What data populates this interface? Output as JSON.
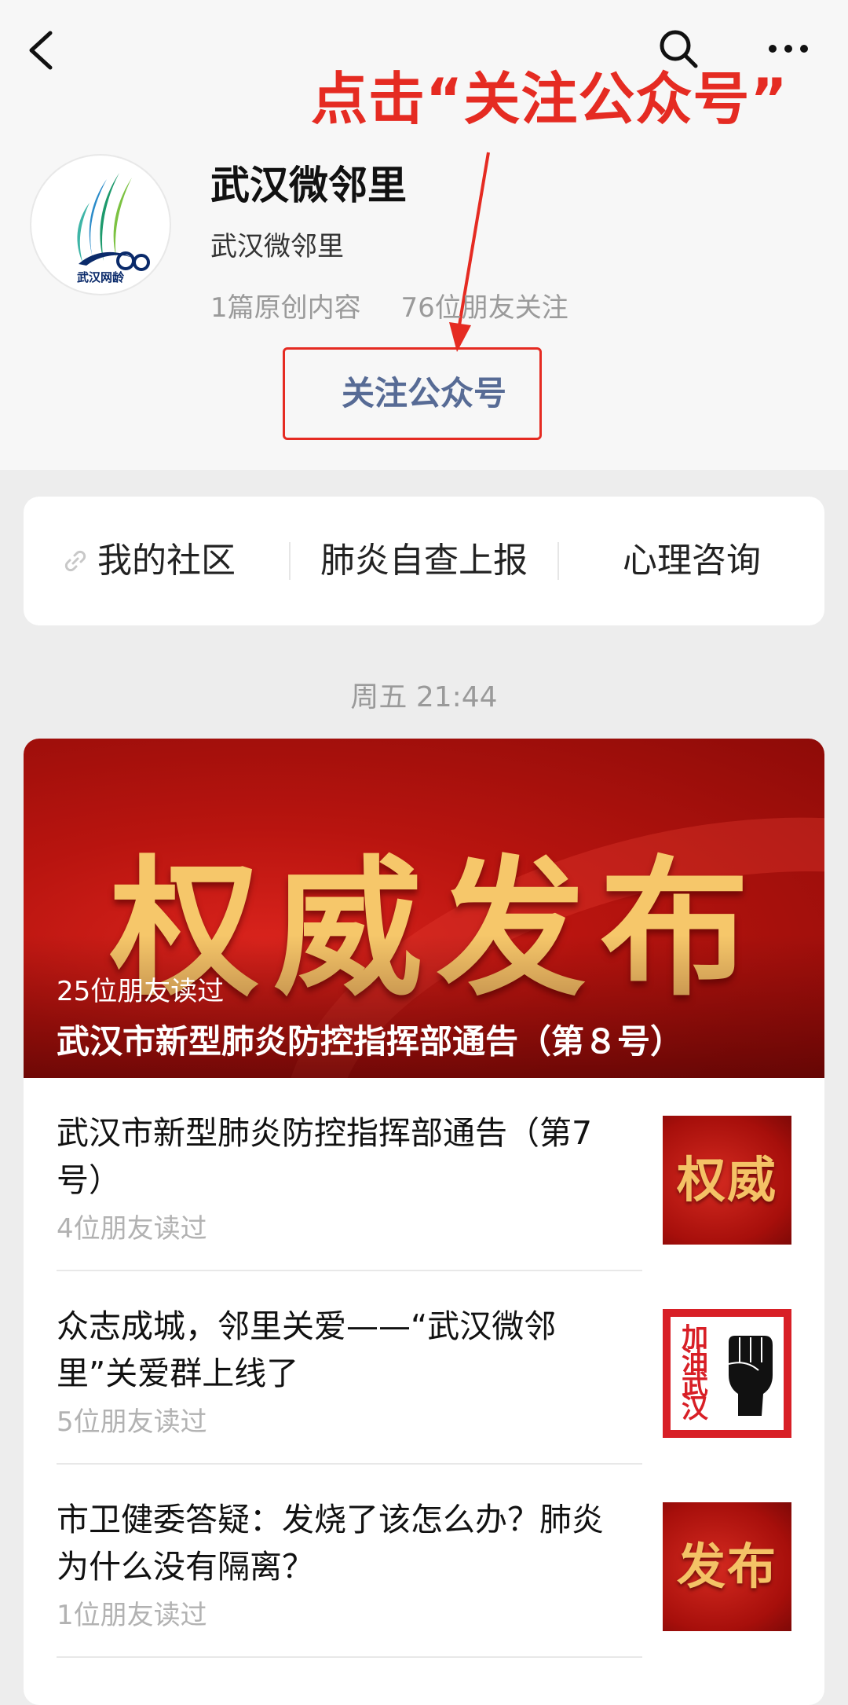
{
  "header": {
    "annotation": "点击“关注公众号”",
    "account_name": "武汉微邻里",
    "account_subtitle": "武汉微邻里",
    "avatar_text": "武汉网龄",
    "stats": [
      "1篇原创内容",
      "76位朋友关注"
    ],
    "follow_label": "关注公众号"
  },
  "menu": {
    "items": [
      "我的社区",
      "肺炎自查上报",
      "心理咨询"
    ]
  },
  "timestamp": "周五 21:44",
  "feature_article": {
    "banner_text": "权威发布",
    "reads": "25位朋友读过",
    "title": "武汉市新型肺炎防控指挥部通告（第８号）"
  },
  "articles": [
    {
      "title": "武汉市新型肺炎防控指挥部通告（第7号）",
      "reads": "4位朋友读过",
      "thumb_text": "权威",
      "thumb_style": "red"
    },
    {
      "title": "众志成城，邻里关爱——“武汉微邻里”关爱群上线了",
      "reads": "5位朋友读过",
      "thumb_text": "加油武汉",
      "thumb_style": "poster"
    },
    {
      "title": "市卫健委答疑：发烧了该怎么办？肺炎为什么没有隔离？",
      "reads": "1位朋友读过",
      "thumb_text": "发布",
      "thumb_style": "red"
    }
  ],
  "colors": {
    "annotation_red": "#e52b22",
    "follow_blue": "#576b95",
    "banner_gold": "#f6c76a"
  }
}
